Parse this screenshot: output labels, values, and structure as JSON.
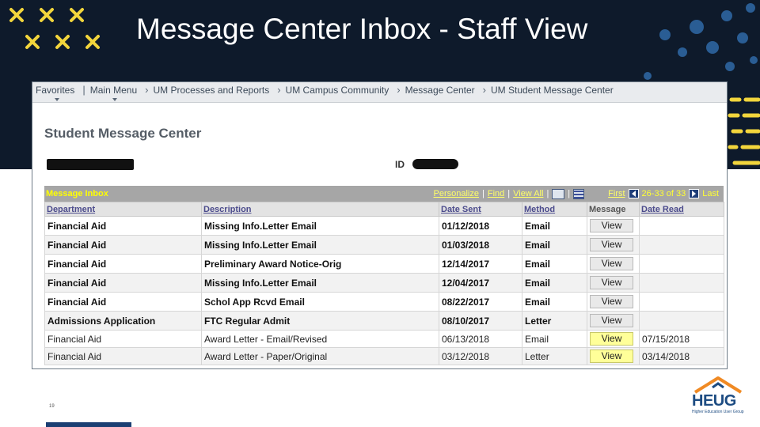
{
  "slide": {
    "title": "Message Center Inbox - Staff View",
    "page_number": "19"
  },
  "colors": {
    "banner": "#0e1a2b",
    "accent_yellow": "#f2d53c",
    "dot_blue": "#2a5d94",
    "grid_header": "#a6a6a6",
    "viewed_button": "#ffff99"
  },
  "breadcrumb": [
    "Favorites",
    "Main Menu",
    "UM Processes and Reports",
    "UM Campus Community",
    "Message Center",
    "UM Student Message Center"
  ],
  "page_title": "Student Message Center",
  "id_label": "ID",
  "grid": {
    "title": "Message Inbox",
    "personalize": "Personalize",
    "find": "Find",
    "view_all": "View All",
    "first": "First",
    "range": "26-33 of 33",
    "last": "Last",
    "columns": [
      "Department",
      "Description",
      "Date Sent",
      "Method",
      "Message",
      "Date Read"
    ],
    "rows": [
      {
        "department": "Financial Aid",
        "description": "Missing Info.Letter Email",
        "date_sent": "01/12/2018",
        "method": "Email",
        "message": "View",
        "date_read": ""
      },
      {
        "department": "Financial Aid",
        "description": "Missing Info.Letter Email",
        "date_sent": "01/03/2018",
        "method": "Email",
        "message": "View",
        "date_read": ""
      },
      {
        "department": "Financial Aid",
        "description": "Preliminary Award Notice-Orig",
        "date_sent": "12/14/2017",
        "method": "Email",
        "message": "View",
        "date_read": ""
      },
      {
        "department": "Financial Aid",
        "description": "Missing Info.Letter Email",
        "date_sent": "12/04/2017",
        "method": "Email",
        "message": "View",
        "date_read": ""
      },
      {
        "department": "Financial Aid",
        "description": "Schol App Rcvd Email",
        "date_sent": "08/22/2017",
        "method": "Email",
        "message": "View",
        "date_read": ""
      },
      {
        "department": "Admissions Application",
        "description": "FTC Regular Admit",
        "date_sent": "08/10/2017",
        "method": "Letter",
        "message": "View",
        "date_read": ""
      },
      {
        "department": "Financial Aid",
        "description": "Award Letter - Email/Revised",
        "date_sent": "06/13/2018",
        "method": "Email",
        "message": "View",
        "date_read": "07/15/2018"
      },
      {
        "department": "Financial Aid",
        "description": "Award Letter - Paper/Original",
        "date_sent": "03/12/2018",
        "method": "Letter",
        "message": "View",
        "date_read": "03/14/2018"
      }
    ]
  },
  "logo": {
    "name": "HEUG",
    "tagline": "Higher Education User Group"
  }
}
